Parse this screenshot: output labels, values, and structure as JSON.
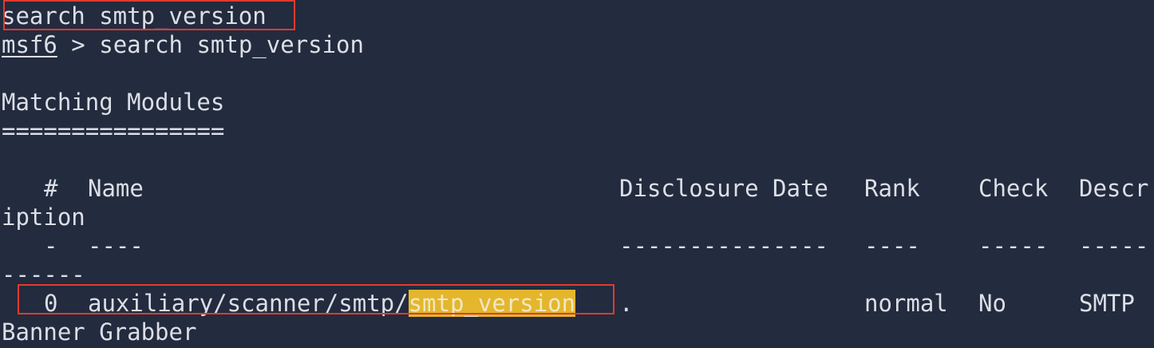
{
  "terminal": {
    "typed_command": "search smtp_version",
    "prompt": {
      "name": "msf6",
      "separator": " > ",
      "command": "search smtp_version"
    },
    "heading": "Matching Modules",
    "heading_rule": "================",
    "table": {
      "headers": {
        "num": "#",
        "name": "Name",
        "date": "Disclosure Date",
        "rank": "Rank",
        "check": "Check",
        "desc_start": "Descr",
        "desc_wrap": "iption"
      },
      "separators": {
        "num": "-",
        "name": "----",
        "date": "---------------",
        "rank": "----",
        "check": "-----",
        "desc_start": "-----",
        "desc_wrap": "------"
      },
      "rows": [
        {
          "num": "0",
          "name_prefix": "auxiliary/scanner/smtp/",
          "name_match": "smtp_version",
          "date": ".",
          "rank": "normal",
          "check": "No",
          "desc_start": "SMTP",
          "desc_wrap": "Banner Grabber"
        }
      ]
    }
  },
  "colors": {
    "background": "#232b3e",
    "text": "#dcdfe6",
    "highlight": "#e4b62c",
    "annotation_box": "#e23a2c"
  }
}
